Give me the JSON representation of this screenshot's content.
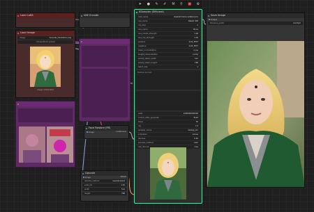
{
  "toolbar": {
    "icons": [
      "cursor-icon",
      "circle-icon",
      "pen-icon",
      "brush-icon",
      "wrench-icon",
      "pin-icon",
      "delete-icon",
      "settings-icon"
    ]
  },
  "load_lora": {
    "title": "Load LoRA"
  },
  "vae_encode": {
    "title": "VAE Encode"
  },
  "load_image": {
    "title": "Load Image",
    "file": "tsunade_illustration.png",
    "button": "choose file to upload",
    "caption": "image 1024x1024"
  },
  "sampler": {
    "title": "KSampler (Efficient)",
    "inputs": [
      "model",
      "positive",
      "negative",
      "latent_image",
      "optional_vae"
    ],
    "widgets": [
      {
        "name": "seed",
        "value": "1000000000000"
      },
      {
        "name": "control_after_generate",
        "value": "fixed"
      },
      {
        "name": "steps",
        "value": "30"
      },
      {
        "name": "cfg",
        "value": "7.0"
      },
      {
        "name": "sampler_name",
        "value": "dpmpp_2m"
      },
      {
        "name": "scheduler",
        "value": "karras"
      },
      {
        "name": "denoise",
        "value": "0.50"
      },
      {
        "name": "preview_method",
        "value": "auto"
      },
      {
        "name": "vae_decode",
        "value": "true"
      }
    ],
    "prompt_label": "Positive prompt",
    "prompt_text": "",
    "negative_text": ""
  },
  "loader": {
    "title": "Efficient Loader",
    "rows": [
      {
        "name": "ckpt_name",
        "value": "RealisticVision.safetensors"
      },
      {
        "name": "vae_name",
        "value": "Baked VAE"
      },
      {
        "name": "clip_skip",
        "value": "-1"
      },
      {
        "name": "lora_name",
        "value": "None"
      },
      {
        "name": "lora_model_strength",
        "value": "1.00"
      },
      {
        "name": "lora_clip_strength",
        "value": "1.00"
      },
      {
        "name": "positive",
        "value": "CLIP_TEXT"
      },
      {
        "name": "negative",
        "value": "CLIP_TEXT"
      },
      {
        "name": "token_normalization",
        "value": "none"
      },
      {
        "name": "weight_interpretation",
        "value": "comfy"
      },
      {
        "name": "empty_latent_width",
        "value": "512"
      },
      {
        "name": "empty_latent_height",
        "value": "768"
      },
      {
        "name": "batch_size",
        "value": "1"
      }
    ]
  },
  "face_restore": {
    "title": "Face Restore (FR)",
    "rows": [
      {
        "name": "model",
        "value": "codeformer"
      }
    ]
  },
  "upscale": {
    "title": "Upscale",
    "rows": [
      {
        "name": "upscale_method",
        "value": "nearest-exact"
      },
      {
        "name": "scale_by",
        "value": "1.50"
      },
      {
        "name": "width",
        "value": "512"
      },
      {
        "name": "height",
        "value": "768"
      },
      {
        "name": "crop",
        "value": "disabled"
      }
    ]
  },
  "preview": {
    "title": "Save Image",
    "prefix_label": "filename_prefix",
    "prefix_value": "ComfyUI"
  }
}
